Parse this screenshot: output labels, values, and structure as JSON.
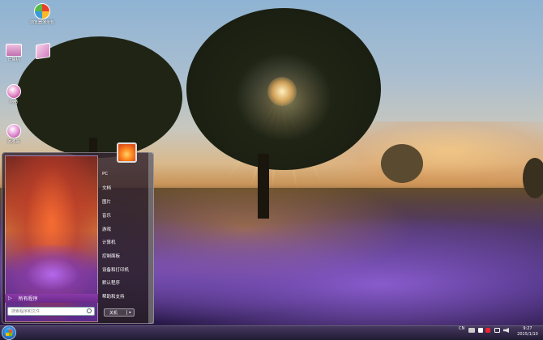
{
  "desktop": {
    "icons": [
      {
        "id": "browser",
        "label": "浏览器演示包"
      },
      {
        "id": "computer",
        "label": "计算机"
      },
      {
        "id": "folder",
        "label": ""
      },
      {
        "id": "network",
        "label": "网络"
      },
      {
        "id": "bin",
        "label": "回收站"
      }
    ]
  },
  "start_menu": {
    "all_programs": "所有程序",
    "search_placeholder": "搜索程序和文件",
    "items": [
      "PC",
      "文档",
      "图片",
      "音乐",
      "游戏",
      "计算机",
      "控制面板",
      "设备和打印机",
      "默认程序",
      "帮助和支持"
    ],
    "shutdown": "关机"
  },
  "taskbar": {
    "lang": "CN",
    "time": "9:27",
    "date": "2015/1/10"
  },
  "colors": {
    "accent": "#8a3aa8",
    "orb": "#2f7fd0"
  }
}
